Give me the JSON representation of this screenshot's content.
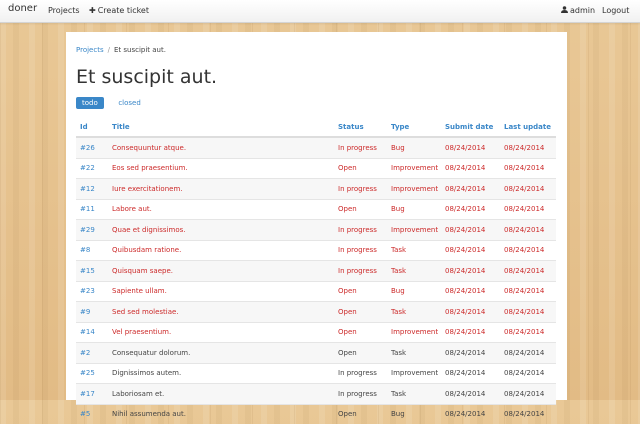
{
  "nav": {
    "brand": "doner",
    "projects": "Projects",
    "create": "Create ticket",
    "user": "admin",
    "logout": "Logout"
  },
  "breadcrumb": {
    "root": "Projects",
    "sep": "/",
    "current": "Et suscipit aut."
  },
  "page_title": "Et suscipit aut.",
  "tabs": [
    "todo",
    "closed"
  ],
  "table": {
    "headers": [
      "Id",
      "Title",
      "Status",
      "Type",
      "Submit date",
      "Last update"
    ],
    "rows": [
      {
        "id": "#26",
        "title": "Consequuntur atque.",
        "status": "In progress",
        "type": "Bug",
        "submit": "08/24/2014",
        "update": "08/24/2014",
        "highlight": true
      },
      {
        "id": "#22",
        "title": "Eos sed praesentium.",
        "status": "Open",
        "type": "Improvement",
        "submit": "08/24/2014",
        "update": "08/24/2014",
        "highlight": true
      },
      {
        "id": "#12",
        "title": "Iure exercitationem.",
        "status": "In progress",
        "type": "Improvement",
        "submit": "08/24/2014",
        "update": "08/24/2014",
        "highlight": true
      },
      {
        "id": "#11",
        "title": "Labore aut.",
        "status": "Open",
        "type": "Bug",
        "submit": "08/24/2014",
        "update": "08/24/2014",
        "highlight": true
      },
      {
        "id": "#29",
        "title": "Quae et dignissimos.",
        "status": "In progress",
        "type": "Improvement",
        "submit": "08/24/2014",
        "update": "08/24/2014",
        "highlight": true
      },
      {
        "id": "#8",
        "title": "Quibusdam ratione.",
        "status": "In progress",
        "type": "Task",
        "submit": "08/24/2014",
        "update": "08/24/2014",
        "highlight": true
      },
      {
        "id": "#15",
        "title": "Quisquam saepe.",
        "status": "In progress",
        "type": "Task",
        "submit": "08/24/2014",
        "update": "08/24/2014",
        "highlight": true
      },
      {
        "id": "#23",
        "title": "Sapiente ullam.",
        "status": "Open",
        "type": "Bug",
        "submit": "08/24/2014",
        "update": "08/24/2014",
        "highlight": true
      },
      {
        "id": "#9",
        "title": "Sed sed molestiae.",
        "status": "Open",
        "type": "Task",
        "submit": "08/24/2014",
        "update": "08/24/2014",
        "highlight": true
      },
      {
        "id": "#14",
        "title": "Vel praesentium.",
        "status": "Open",
        "type": "Improvement",
        "submit": "08/24/2014",
        "update": "08/24/2014",
        "highlight": true
      },
      {
        "id": "#2",
        "title": "Consequatur dolorum.",
        "status": "Open",
        "type": "Task",
        "submit": "08/24/2014",
        "update": "08/24/2014",
        "highlight": false
      },
      {
        "id": "#25",
        "title": "Dignissimos autem.",
        "status": "In progress",
        "type": "Improvement",
        "submit": "08/24/2014",
        "update": "08/24/2014",
        "highlight": false
      },
      {
        "id": "#17",
        "title": "Laboriosam et.",
        "status": "In progress",
        "type": "Task",
        "submit": "08/24/2014",
        "update": "08/24/2014",
        "highlight": false
      },
      {
        "id": "#5",
        "title": "Nihil assumenda aut.",
        "status": "Open",
        "type": "Bug",
        "submit": "08/24/2014",
        "update": "08/24/2014",
        "highlight": false
      }
    ]
  },
  "colors": {
    "accent": "#3a87c8",
    "overdue": "#cc2a2a"
  },
  "icons": {
    "create": "plus-icon",
    "user": "user-icon"
  }
}
